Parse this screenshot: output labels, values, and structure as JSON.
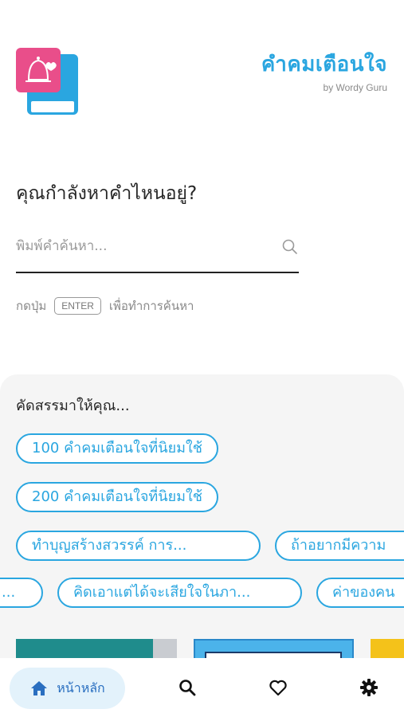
{
  "app": {
    "title": "คำคมเตือนใจ",
    "byline": "by Wordy Guru",
    "logo_icon": "bell-heart-book-logo",
    "accent_color": "#2aa6e0",
    "logo_pink": "#e94e8a"
  },
  "search": {
    "heading": "คุณกำลังหาคำไหนอยู่?",
    "placeholder": "พิมพ์คำค้นหา...",
    "hint_prefix": "กดปุ่ม",
    "hint_key": "ENTER",
    "hint_suffix": "เพื่อทำการค้นหา"
  },
  "suggestions": {
    "title": "คัดสรรมาให้คุณ...",
    "chips": [
      "100 คำคมเตือนใจที่นิยมใช้",
      "200 คำคมเตือนใจที่นิยมใช้",
      "ทำบุญสร้างสวรรค์ การ...",
      "ถ้าอยากมีความ",
      "...",
      "คิดเอาแต่ได้จะเสียใจในภา...",
      "ค่าของคน"
    ]
  },
  "bottom_nav": {
    "home_label": "หน้าหลัก",
    "icons": [
      "home-icon",
      "search-icon",
      "heart-icon",
      "gear-icon"
    ]
  }
}
